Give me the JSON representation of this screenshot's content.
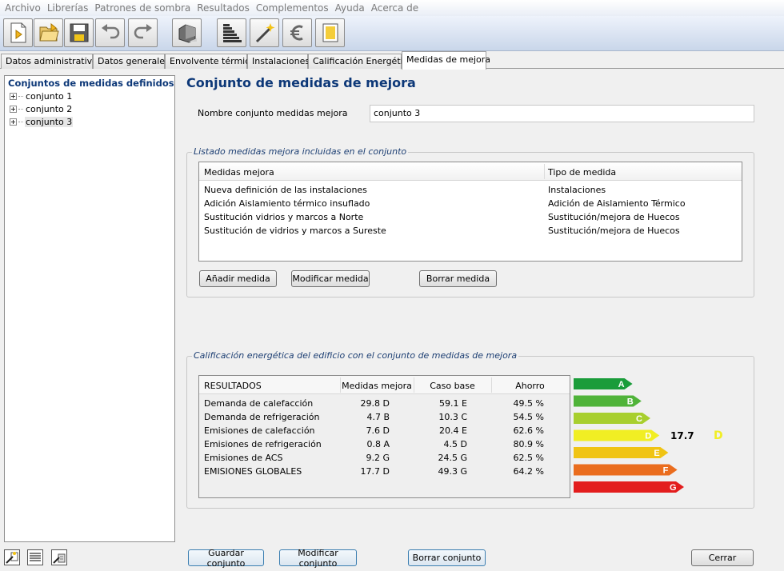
{
  "menu": [
    "Archivo",
    "Librerías",
    "Patrones de sombra",
    "Resultados",
    "Complementos",
    "Ayuda",
    "Acerca de"
  ],
  "toolbar": {
    "buttons": [
      "new-file-icon",
      "open-folder-icon",
      "save-icon",
      "undo-icon",
      "redo-icon",
      "building-icon",
      "energy-rating-icon",
      "magic-wand-icon",
      "euro-icon",
      "report-icon"
    ]
  },
  "tabs": [
    "Datos administrativos",
    "Datos generales",
    "Envolvente térmica",
    "Instalaciones",
    "Calificación Energética",
    "Medidas de mejora"
  ],
  "active_tab": "Medidas de mejora",
  "tree": {
    "title": "Conjuntos de medidas definidos",
    "items": [
      "conjunto 1",
      "conjunto 2",
      "conjunto 3"
    ],
    "selected": "conjunto 3"
  },
  "main": {
    "title": "Conjunto de medidas de mejora",
    "name_label": "Nombre conjunto medidas mejora",
    "name_value": "conjunto 3"
  },
  "measures": {
    "legend": "Listado medidas mejora incluidas en el conjunto",
    "columns": [
      "Medidas mejora",
      "Tipo de medida"
    ],
    "rows": [
      [
        "Nueva definición de las instalaciones",
        "Instalaciones"
      ],
      [
        "Adición Aislamiento térmico insuflado",
        "Adición de Aislamiento Térmico"
      ],
      [
        "Sustitución vidrios y marcos a Norte",
        "Sustitución/mejora de Huecos"
      ],
      [
        "Sustitución de vidrios y marcos a Sureste",
        "Sustitución/mejora de Huecos"
      ]
    ],
    "buttons": {
      "add": "Añadir medida",
      "modify": "Modificar medida",
      "delete": "Borrar medida"
    }
  },
  "rating": {
    "legend": "Calificación energética del edificio con el conjunto de medidas de mejora",
    "columns": [
      "RESULTADOS",
      "Medidas mejora",
      "Caso base",
      "Ahorro"
    ],
    "rows": [
      [
        "Demanda de calefacción",
        "29.8 D",
        "59.1 E",
        "49.5 %"
      ],
      [
        "Demanda de refrigeración",
        "4.7 B",
        "10.3 C",
        "54.5 %"
      ],
      [
        "Emisiones de calefacción",
        "7.6 D",
        "20.4 E",
        "62.6 %"
      ],
      [
        "Emisiones de refrigeración",
        "0.8 A",
        "4.5 D",
        "80.9 %"
      ],
      [
        "Emisiones de ACS",
        "9.2 G",
        "24.5 G",
        "62.5 %"
      ],
      [
        "EMISIONES GLOBALES",
        "17.7 D",
        "49.3 G",
        "64.2 %"
      ]
    ],
    "scale": [
      {
        "letter": "A",
        "color": "#1a9c3a",
        "fraction": 0.54
      },
      {
        "letter": "B",
        "color": "#4fb339",
        "fraction": 0.62
      },
      {
        "letter": "C",
        "color": "#a8cf2e",
        "fraction": 0.7
      },
      {
        "letter": "D",
        "color": "#f1ee23",
        "fraction": 0.78
      },
      {
        "letter": "E",
        "color": "#f0c414",
        "fraction": 0.86
      },
      {
        "letter": "F",
        "color": "#ea6d1e",
        "fraction": 0.94
      },
      {
        "letter": "G",
        "color": "#e31d1d",
        "fraction": 1.0
      }
    ],
    "score_value": "17.7",
    "score_letter": "D",
    "score_color": "#f1ee23"
  },
  "footer": {
    "save": "Guardar conjunto",
    "modify": "Modificar conjunto",
    "delete": "Borrar conjunto",
    "close": "Cerrar"
  }
}
